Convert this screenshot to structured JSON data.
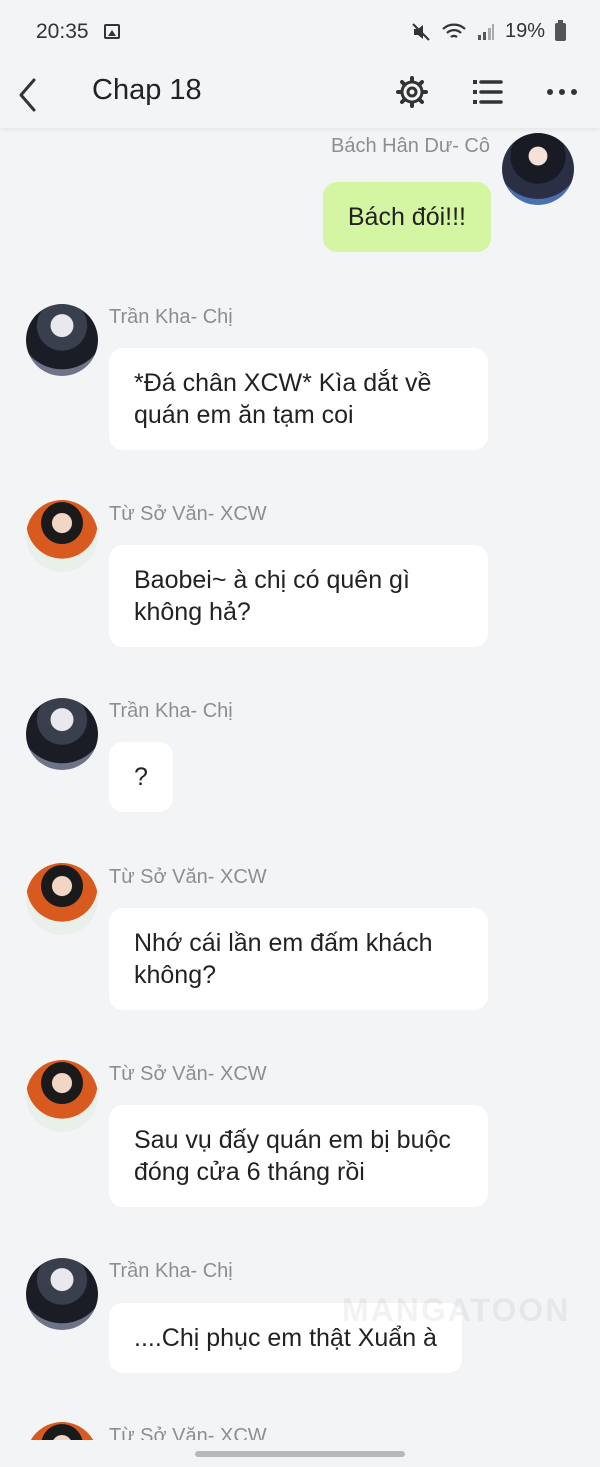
{
  "status": {
    "time": "20:35",
    "battery": "19%"
  },
  "header": {
    "title": "Chap 18"
  },
  "watermark": "MANGATOON",
  "messages": [
    {
      "sender": "Bách Hân Dư- Cô",
      "text": "Bách đói!!!"
    },
    {
      "sender": "Trần Kha- Chị",
      "text": "*Đá chân XCW* Kìa dắt về quán em ăn tạm coi"
    },
    {
      "sender": "Từ Sở Văn- XCW",
      "text": "Baobei~ à chị có quên gì không hả?"
    },
    {
      "sender": "Trần Kha- Chị",
      "text": "?"
    },
    {
      "sender": "Từ Sở Văn- XCW",
      "text": "Nhớ cái lần em đấm khách không?"
    },
    {
      "sender": "Từ Sở Văn- XCW",
      "text": "Sau vụ đấy quán em bị buộc đóng cửa 6 tháng rồi"
    },
    {
      "sender": "Trần Kha- Chị",
      "text": "....Chị phục em thật Xuẩn à"
    },
    {
      "sender": "Từ Sở Văn- XCW",
      "text": ""
    }
  ],
  "icons": {
    "back": "chevron-left-icon",
    "settings": "gear-icon",
    "list": "list-icon",
    "more": "more-horizontal-icon",
    "mute": "mute-icon",
    "wifi": "wifi-icon",
    "signal": "signal-icon",
    "gallery": "image-icon"
  }
}
